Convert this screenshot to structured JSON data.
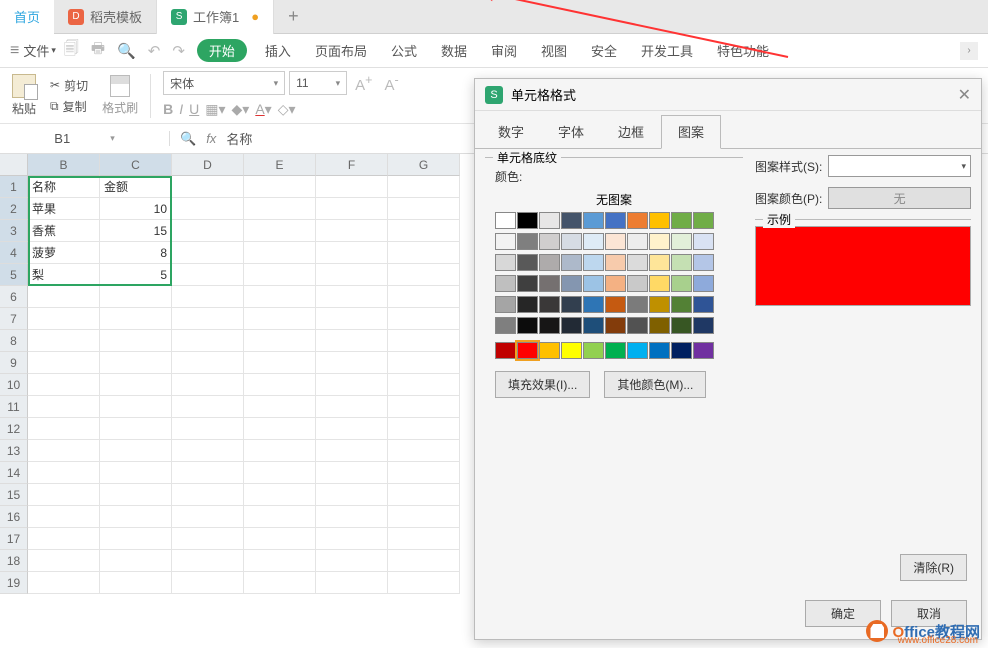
{
  "tabs": {
    "home": "首页",
    "docu1": "稻壳模板",
    "docu2": "工作簿1"
  },
  "menu": {
    "file": "文件",
    "start": "开始",
    "insert": "插入",
    "layout": "页面布局",
    "formula": "公式",
    "data": "数据",
    "review": "审阅",
    "view": "视图",
    "security": "安全",
    "dev": "开发工具",
    "special": "特色功能"
  },
  "toolbar": {
    "paste": "粘贴",
    "cut": "剪切",
    "copy": "复制",
    "brush": "格式刷",
    "font_name": "宋体",
    "font_size": "11"
  },
  "namebox": "B1",
  "formula_value": "名称",
  "columns": [
    "B",
    "C",
    "D",
    "E",
    "F",
    "G"
  ],
  "rows_shown": 19,
  "selected_rows": [
    1,
    2,
    3,
    4,
    5
  ],
  "data_rows": [
    {
      "b": "名称",
      "c": "金额"
    },
    {
      "b": "苹果",
      "c": "10"
    },
    {
      "b": "香蕉",
      "c": "15"
    },
    {
      "b": "菠萝",
      "c": "8"
    },
    {
      "b": "梨",
      "c": "5"
    }
  ],
  "dialog": {
    "title": "单元格格式",
    "tabs": {
      "number": "数字",
      "font": "字体",
      "border": "边框",
      "pattern": "图案"
    },
    "shading_group": "单元格底纹",
    "color_label": "颜色:",
    "no_pattern": "无图案",
    "fill_effects": "填充效果(I)...",
    "more_colors": "其他颜色(M)...",
    "pattern_style": "图案样式(S):",
    "pattern_color": "图案颜色(P):",
    "pattern_color_value": "无",
    "sample": "示例",
    "clear": "清除(R)",
    "ok": "确定",
    "cancel": "取消"
  },
  "palette_rows": [
    [
      "#ffffff",
      "#000000",
      "#e7e6e6",
      "#44546a",
      "#5b9bd5",
      "#4472c4",
      "#ed7d31",
      "#ffc000",
      "#70ad47",
      "#70ad47"
    ],
    [
      "#f2f2f2",
      "#7f7f7f",
      "#d0cece",
      "#d6dce4",
      "#deebf6",
      "#fbe5d5",
      "#ededed",
      "#fff2cc",
      "#e2efd9",
      "#d9e2f3"
    ],
    [
      "#d8d8d8",
      "#595959",
      "#aeabab",
      "#adb9ca",
      "#bdd7ee",
      "#f7cbac",
      "#dbdbdb",
      "#fee599",
      "#c5e0b3",
      "#b4c6e7"
    ],
    [
      "#bfbfbf",
      "#3f3f3f",
      "#757070",
      "#8496b0",
      "#9cc3e5",
      "#f4b183",
      "#c9c9c9",
      "#ffd965",
      "#a8d08d",
      "#8eaadb"
    ],
    [
      "#a5a5a5",
      "#262626",
      "#3a3838",
      "#323f4f",
      "#2e75b5",
      "#c55a11",
      "#7b7b7b",
      "#bf9000",
      "#538135",
      "#2f5496"
    ],
    [
      "#7f7f7f",
      "#0c0c0c",
      "#171616",
      "#222a35",
      "#1e4e79",
      "#833c0b",
      "#525252",
      "#7f6000",
      "#375623",
      "#1f3864"
    ]
  ],
  "palette_std": [
    "#c00000",
    "#ff0000",
    "#ffc000",
    "#ffff00",
    "#92d050",
    "#00b050",
    "#00b0f0",
    "#0070c0",
    "#002060",
    "#7030a0"
  ],
  "watermark": {
    "brand_o": "O",
    "brand_rest": "ffice教程网",
    "url": "www.office28.com"
  }
}
